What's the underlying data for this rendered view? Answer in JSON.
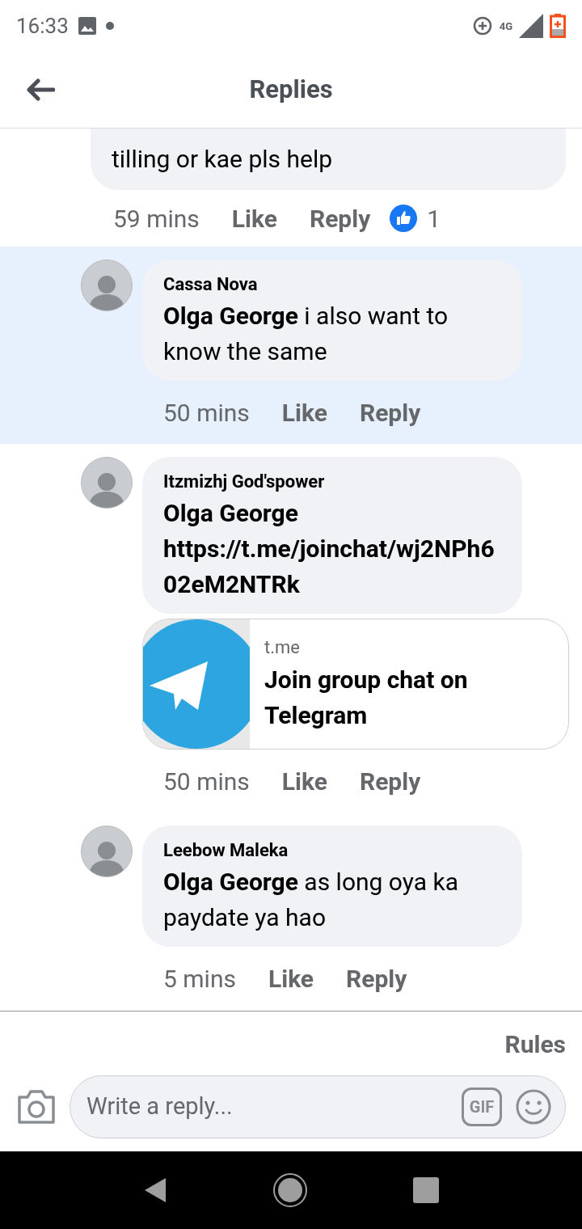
{
  "status_bar": {
    "time": "16:33",
    "network": "4G"
  },
  "header": {
    "title": "Replies"
  },
  "top_comment": {
    "text": "tilling or kae pls help",
    "time": "59 mins",
    "like": "Like",
    "reply": "Reply",
    "reaction_count": "1"
  },
  "comments": [
    {
      "author": "Cassa Nova",
      "body": "**Olga George** i also want to know the same",
      "time": "50 mins",
      "like": "Like",
      "reply": "Reply",
      "highlighted": true
    },
    {
      "author": "Itzmizhj God'spower",
      "body": "**Olga George https://t.me/joinchat/wj2NPh602eM2NTRk**",
      "time": "50 mins",
      "like": "Like",
      "reply": "Reply",
      "highlighted": false,
      "link_preview": {
        "domain": "t.me",
        "title": "Join group chat on Telegram"
      }
    },
    {
      "author": "Leebow Maleka",
      "body": "**Olga George** as long oya ka paydate ya hao",
      "time": "5 mins",
      "like": "Like",
      "reply": "Reply",
      "highlighted": false
    }
  ],
  "rules": "Rules",
  "composer": {
    "placeholder": "Write a reply...",
    "gif_label": "GIF"
  }
}
